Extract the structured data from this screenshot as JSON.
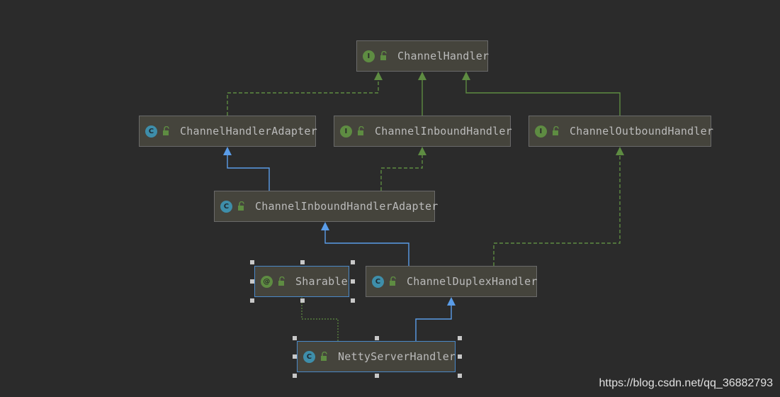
{
  "nodes": [
    {
      "id": "ChannelHandler",
      "label": "ChannelHandler",
      "kind": "I"
    },
    {
      "id": "ChannelHandlerAdapter",
      "label": "ChannelHandlerAdapter",
      "kind": "C"
    },
    {
      "id": "ChannelInboundHandler",
      "label": "ChannelInboundHandler",
      "kind": "I"
    },
    {
      "id": "ChannelOutboundHandler",
      "label": "ChannelOutboundHandler",
      "kind": "I"
    },
    {
      "id": "ChannelInboundHandlerAdapter",
      "label": "ChannelInboundHandlerAdapter",
      "kind": "C"
    },
    {
      "id": "Sharable",
      "label": "Sharable",
      "kind": "@"
    },
    {
      "id": "ChannelDuplexHandler",
      "label": "ChannelDuplexHandler",
      "kind": "C"
    },
    {
      "id": "NettyServerHandler",
      "label": "NettyServerHandler",
      "kind": "C"
    }
  ],
  "edges": [
    {
      "from": "ChannelHandlerAdapter",
      "to": "ChannelHandler",
      "type": "implements"
    },
    {
      "from": "ChannelInboundHandler",
      "to": "ChannelHandler",
      "type": "extends-interface"
    },
    {
      "from": "ChannelOutboundHandler",
      "to": "ChannelHandler",
      "type": "extends-interface"
    },
    {
      "from": "ChannelInboundHandlerAdapter",
      "to": "ChannelHandlerAdapter",
      "type": "extends"
    },
    {
      "from": "ChannelInboundHandlerAdapter",
      "to": "ChannelInboundHandler",
      "type": "implements"
    },
    {
      "from": "ChannelDuplexHandler",
      "to": "ChannelInboundHandlerAdapter",
      "type": "extends"
    },
    {
      "from": "ChannelDuplexHandler",
      "to": "ChannelOutboundHandler",
      "type": "implements"
    },
    {
      "from": "NettyServerHandler",
      "to": "ChannelDuplexHandler",
      "type": "extends"
    },
    {
      "from": "NettyServerHandler",
      "to": "Sharable",
      "type": "annotated"
    }
  ],
  "colors": {
    "background": "#2b2b2b",
    "implements": "#5e8c42",
    "extends": "#5a9ce8",
    "annotated": "#5e8c42",
    "selection": "#4a88c7"
  },
  "watermark": "https://blog.csdn.net/qq_36882793"
}
